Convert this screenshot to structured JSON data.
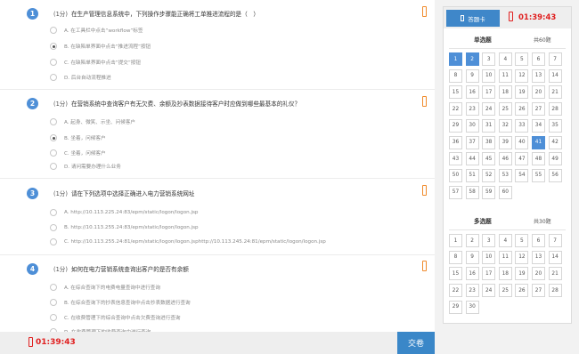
{
  "questions": [
    {
      "number": "1",
      "score": "(1分)",
      "text": "在生产管理信息系统中，下列操作步骤能正确将工单推进流程的是（　）",
      "options": [
        {
          "label": "A. 在工具栏中点击“workflow”标签",
          "checked": false
        },
        {
          "label": "B. 在缺陷单界面中点击“推进流程”按钮",
          "checked": true
        },
        {
          "label": "C. 在缺陷单界面中点击“提交”按钮",
          "checked": false
        },
        {
          "label": "D. 后台自动流程推进",
          "checked": false
        }
      ]
    },
    {
      "number": "2",
      "score": "(1分)",
      "text": "在营销系统中查询客户有无欠费、余额及抄表数据接待客户时应做到哪些最基本的礼仪？",
      "options": [
        {
          "label": "A. 起身、微笑、示坐、问候客户",
          "checked": false
        },
        {
          "label": "B. 坐着，问候客户",
          "checked": true
        },
        {
          "label": "C. 坐着，问候客户",
          "checked": false
        },
        {
          "label": "D. 请问需要办理什么业务",
          "checked": false
        }
      ]
    },
    {
      "number": "3",
      "score": "(1分)",
      "text": "请在下列选项中选择正确进入电力营销系统网址",
      "options": [
        {
          "label": "A. http://10.113.225.24:83/epm/static/logon/logon.jsp",
          "checked": false
        },
        {
          "label": "B. http://10.113.255.24:83/epm/static/logon/logon.jsp",
          "checked": false
        },
        {
          "label": "C. http://10.113.255.24:81/epm/static/logon/logon.jsphttp://10.113.245.24:81/epm/static/logon/logon.jsp",
          "checked": false
        }
      ]
    },
    {
      "number": "4",
      "score": "(1分)",
      "text": "如何在电力营销系统查询出客户的是否有余额",
      "options": [
        {
          "label": "A. 在综合查询下的电费电量查询中进行查询",
          "checked": false
        },
        {
          "label": "B. 在综合查询下的抄表信息查询中点击抄表数据进行查询",
          "checked": false
        },
        {
          "label": "C. 在收费管理下的综合查询中点击欠费查询进行查询",
          "checked": false
        },
        {
          "label": "D. 在收费管理下的收费查询中进行查询",
          "checked": false
        }
      ]
    }
  ],
  "bottom": {
    "timer": "01:39:43",
    "submit_label": "交卷"
  },
  "card": {
    "tab_label": "答题卡",
    "timer": "01:39:43",
    "single": {
      "title": "单选题",
      "count": "共60题",
      "active": [
        "1",
        "2",
        "41"
      ],
      "numbers": [
        "1",
        "2",
        "3",
        "4",
        "5",
        "6",
        "7",
        "8",
        "9",
        "10",
        "11",
        "12",
        "13",
        "14",
        "15",
        "16",
        "17",
        "18",
        "19",
        "20",
        "21",
        "22",
        "23",
        "24",
        "25",
        "26",
        "27",
        "28",
        "29",
        "30",
        "31",
        "32",
        "33",
        "34",
        "35",
        "36",
        "37",
        "38",
        "39",
        "40",
        "41",
        "42",
        "43",
        "44",
        "45",
        "46",
        "47",
        "48",
        "49",
        "50",
        "51",
        "52",
        "53",
        "54",
        "55",
        "56",
        "57",
        "58",
        "59",
        "60"
      ]
    },
    "multi": {
      "title": "多选题",
      "count": "共30题",
      "active": [],
      "numbers": [
        "1",
        "2",
        "3",
        "4",
        "5",
        "6",
        "7",
        "8",
        "9",
        "10",
        "11",
        "12",
        "13",
        "14",
        "15",
        "16",
        "17",
        "18",
        "19",
        "20",
        "21",
        "22",
        "23",
        "24",
        "25",
        "26",
        "27",
        "28",
        "29",
        "30"
      ]
    }
  },
  "colors": {
    "accent": "#4e8fd7",
    "tab": "#3f87c9",
    "submit": "#3a87c8",
    "timer": "#e02020",
    "mark": "#f08a2a"
  },
  "icons": {
    "flag": "flag-marker-icon",
    "alarm": "alarm-clock-icon",
    "card": "answer-card-icon"
  }
}
